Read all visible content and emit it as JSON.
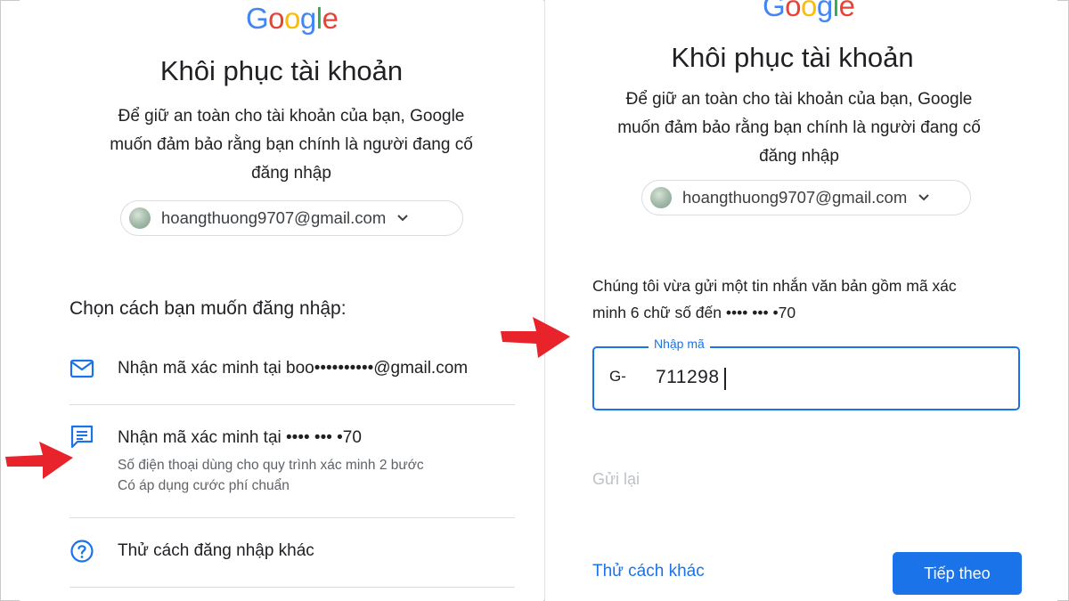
{
  "colors": {
    "accent": "#1a73e8",
    "arrow": "#e8232b",
    "text_primary": "#202124",
    "text_secondary": "#5f6368",
    "disabled": "#bdc1c6",
    "google_blue": "#4285F4",
    "google_red": "#EA4335",
    "google_yellow": "#FBBC05",
    "google_green": "#34A853"
  },
  "left": {
    "logo": [
      "G",
      "o",
      "o",
      "g",
      "l",
      "e"
    ],
    "title": "Khôi phục tài khoản",
    "subtitle_lines": [
      "Để giữ an toàn cho tài khoản của bạn, Google",
      "muốn đảm bảo rằng bạn chính là người đang cố",
      "đăng nhập"
    ],
    "account": "hoangthuong9707@gmail.com",
    "section_heading": "Chọn cách bạn muốn đăng nhập:",
    "options": [
      {
        "icon": "mail-icon",
        "label": "Nhận mã xác minh tại boo••••••••••@gmail.com"
      },
      {
        "icon": "message-icon",
        "label": "Nhận mã xác minh tại •••• ••• •70",
        "sub1": "Số điện thoại dùng cho quy trình xác minh 2 bước",
        "sub2": "Có áp dụng cước phí chuẩn"
      },
      {
        "icon": "help-circle-icon",
        "label": "Thử cách đăng nhập khác"
      }
    ]
  },
  "right": {
    "logo": [
      "G",
      "o",
      "o",
      "g",
      "l",
      "e"
    ],
    "title": "Khôi phục tài khoản",
    "subtitle_lines": [
      "Để giữ an toàn cho tài khoản của bạn, Google",
      "muốn đảm bảo rằng bạn chính là người đang cố",
      "đăng nhập"
    ],
    "account": "hoangthuong9707@gmail.com",
    "message_lines": [
      "Chúng tôi vừa gửi một tin nhắn văn bản gồm mã xác",
      "minh 6 chữ số đến •••• ••• •70"
    ],
    "code_field": {
      "label": "Nhập mã",
      "prefix": "G-",
      "value": "711298"
    },
    "resend": "Gửi lại",
    "try_another": "Thử cách khác",
    "next_button": "Tiếp theo"
  }
}
